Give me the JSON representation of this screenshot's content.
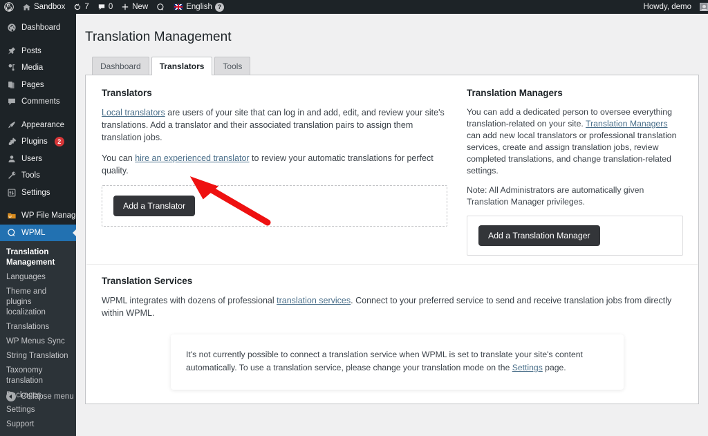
{
  "adminbar": {
    "wp_logo_icon": "wordpress-logo-icon",
    "site_name": "Sandbox",
    "site_icon": "home-icon",
    "updates_icon": "updates-icon",
    "updates_count": "7",
    "comments_icon": "comment-bubble-icon",
    "comments_count": "0",
    "new_icon": "plus-icon",
    "new_label": "New",
    "wpml_icon": "wpml-icon",
    "language_flag_icon": "english-flag-icon",
    "language_label": "English",
    "help_label": "?",
    "howdy": "Howdy, demo",
    "avatar_icon": "avatar-icon"
  },
  "sidebar": {
    "items": [
      {
        "label": "Dashboard",
        "icon": "dashboard-icon"
      },
      {
        "label": "Posts",
        "icon": "pin-icon"
      },
      {
        "label": "Media",
        "icon": "media-icon"
      },
      {
        "label": "Pages",
        "icon": "pages-icon"
      },
      {
        "label": "Comments",
        "icon": "comment-bubble-icon"
      },
      {
        "label": "Appearance",
        "icon": "paintbrush-icon"
      },
      {
        "label": "Plugins",
        "icon": "plug-icon",
        "badge": "2"
      },
      {
        "label": "Users",
        "icon": "user-icon"
      },
      {
        "label": "Tools",
        "icon": "wrench-icon"
      },
      {
        "label": "Settings",
        "icon": "sliders-icon"
      },
      {
        "label": "WP File Manager",
        "icon": "folder-icon"
      },
      {
        "label": "WPML",
        "icon": "wpml-icon",
        "active": true
      }
    ],
    "submenu": [
      {
        "label": "Translation Management",
        "current": true
      },
      {
        "label": "Languages"
      },
      {
        "label": "Theme and plugins localization"
      },
      {
        "label": "Translations"
      },
      {
        "label": "WP Menus Sync"
      },
      {
        "label": "String Translation"
      },
      {
        "label": "Taxonomy translation"
      },
      {
        "label": "Packages"
      },
      {
        "label": "Settings"
      },
      {
        "label": "Support"
      }
    ],
    "collapse_label": "Collapse menu",
    "collapse_icon": "collapse-arrow-icon"
  },
  "page": {
    "title": "Translation Management",
    "tabs": [
      {
        "label": "Dashboard",
        "active": false
      },
      {
        "label": "Translators",
        "active": true
      },
      {
        "label": "Tools",
        "active": false
      }
    ]
  },
  "translators": {
    "title": "Translators",
    "p1_link": "Local translators",
    "p1_rest": " are users of your site that can log in and add, edit, and review your site's translations. Add a translator and their associated translation pairs to assign them translation jobs.",
    "p2_pre": "You can ",
    "p2_link": "hire an experienced translator",
    "p2_rest": " to review your automatic translations for perfect quality.",
    "add_button": "Add a Translator"
  },
  "translation_managers": {
    "title": "Translation Managers",
    "p1_pre": "You can add a dedicated person to oversee everything translation-related on your site. ",
    "p1_link": "Translation Managers",
    "p1_rest": " can add new local translators or professional translation services, create and assign translation jobs, review completed translations, and change translation-related settings.",
    "p2": "Note: All Administrators are automatically given Translation Manager privileges.",
    "add_button": "Add a Translation Manager"
  },
  "translation_services": {
    "title": "Translation Services",
    "p1_pre": "WPML integrates with dozens of professional ",
    "p1_link": "translation services",
    "p1_rest": ". Connect to your preferred service to send and receive translation jobs from directly within WPML.",
    "notice_pre": "It's not currently possible to connect a translation service when WPML is set to translate your site's content automatically. To use a translation service, please change your translation mode on the ",
    "notice_link": "Settings",
    "notice_rest": " page."
  },
  "annotation": {
    "arrow_icon": "red-arrow-annotation",
    "color": "#ee1111"
  },
  "colors": {
    "admin_dark": "#1d2327",
    "submenu_dark": "#2c3338",
    "accent_blue": "#2271b1",
    "badge_red": "#d63638",
    "page_bg": "#f0f0f1",
    "button_dark": "#333539",
    "link_blue": "#4a6f8a"
  }
}
